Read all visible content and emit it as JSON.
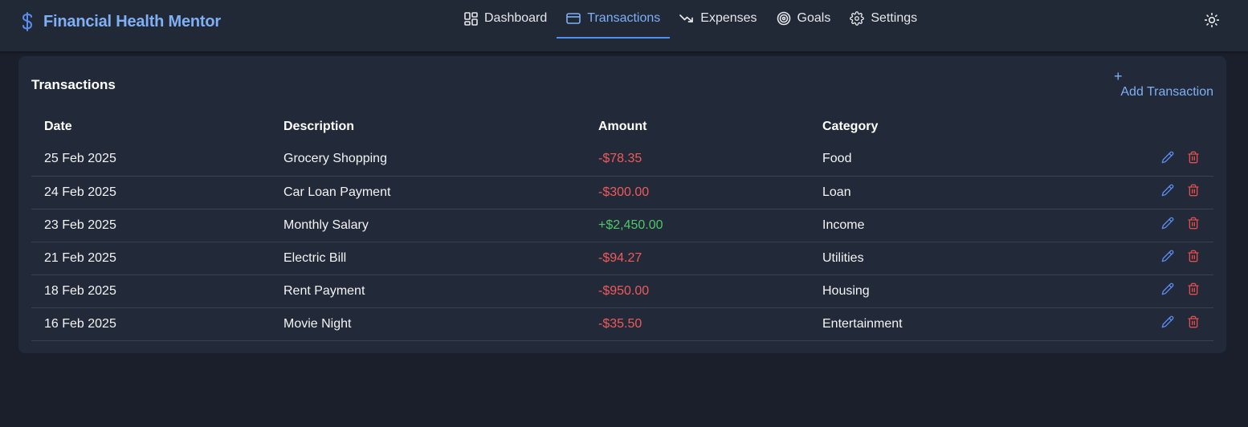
{
  "app": {
    "title": "Financial Health Mentor",
    "brand_icon": "dollar-sign-icon",
    "accent_color": "#7fb0f5"
  },
  "nav": {
    "items": [
      {
        "label": "Dashboard",
        "icon": "dashboard-grid-icon",
        "active": false
      },
      {
        "label": "Transactions",
        "icon": "credit-card-icon",
        "active": true
      },
      {
        "label": "Expenses",
        "icon": "trending-down-icon",
        "active": false
      },
      {
        "label": "Goals",
        "icon": "target-icon",
        "active": false
      },
      {
        "label": "Settings",
        "icon": "gear-icon",
        "active": false
      }
    ],
    "theme_toggle_icon": "sun-icon"
  },
  "transactions": {
    "title": "Transactions",
    "add_label": "Add Transaction",
    "add_icon": "plus-icon",
    "columns": [
      "Date",
      "Description",
      "Amount",
      "Category"
    ],
    "rows": [
      {
        "date": "25 Feb 2025",
        "description": "Grocery Shopping",
        "amount": "-$78.35",
        "type": "expense",
        "category": "Food"
      },
      {
        "date": "24 Feb 2025",
        "description": "Car Loan Payment",
        "amount": "-$300.00",
        "type": "expense",
        "category": "Loan"
      },
      {
        "date": "23 Feb 2025",
        "description": "Monthly Salary",
        "amount": "+$2,450.00",
        "type": "income",
        "category": "Income"
      },
      {
        "date": "21 Feb 2025",
        "description": "Electric Bill",
        "amount": "-$94.27",
        "type": "expense",
        "category": "Utilities"
      },
      {
        "date": "18 Feb 2025",
        "description": "Rent Payment",
        "amount": "-$950.00",
        "type": "expense",
        "category": "Housing"
      },
      {
        "date": "16 Feb 2025",
        "description": "Movie Night",
        "amount": "-$35.50",
        "type": "expense",
        "category": "Entertainment"
      }
    ],
    "row_actions": [
      "edit-pencil-icon",
      "trash-icon"
    ],
    "colors": {
      "expense": "#ef5b5b",
      "income": "#4ec866",
      "edit": "#5b8def",
      "delete": "#e24d4d"
    }
  }
}
